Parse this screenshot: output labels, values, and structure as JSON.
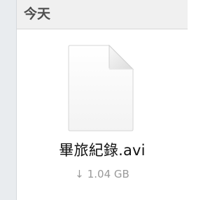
{
  "section": {
    "title": "今天"
  },
  "file": {
    "name": "畢旅紀錄.avi",
    "download_arrow": "↓",
    "size": "1.04 GB",
    "icon": "document-icon"
  },
  "colors": {
    "header_bg": "#f0f0f0",
    "sidebar_bg": "#e9ecef",
    "meta_text": "#9a9a9a"
  }
}
